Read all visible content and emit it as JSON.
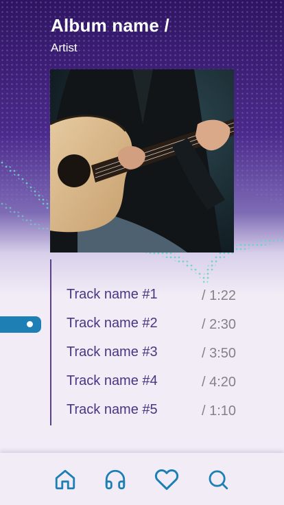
{
  "album": {
    "title": "Album name /",
    "artist": "Artist"
  },
  "tracks": [
    {
      "name": "Track name #1",
      "duration": "/ 1:22"
    },
    {
      "name": "Track name #2",
      "duration": "/ 2:30"
    },
    {
      "name": "Track name #3",
      "duration": "/ 3:50"
    },
    {
      "name": "Track name #4",
      "duration": "/ 4:20"
    },
    {
      "name": "Track name #5",
      "duration": "/ 1:10"
    }
  ],
  "nav": {
    "items": [
      {
        "icon": "home-icon"
      },
      {
        "icon": "headphones-icon"
      },
      {
        "icon": "heart-icon"
      },
      {
        "icon": "search-icon"
      }
    ]
  },
  "colors": {
    "header_purple": "#3e1a6e",
    "accent_blue": "#1d7fb3",
    "track_text": "#4b3582",
    "duration_text": "#858189",
    "teal_dots": "#6fd1c8",
    "background": "#f1ecf6"
  }
}
